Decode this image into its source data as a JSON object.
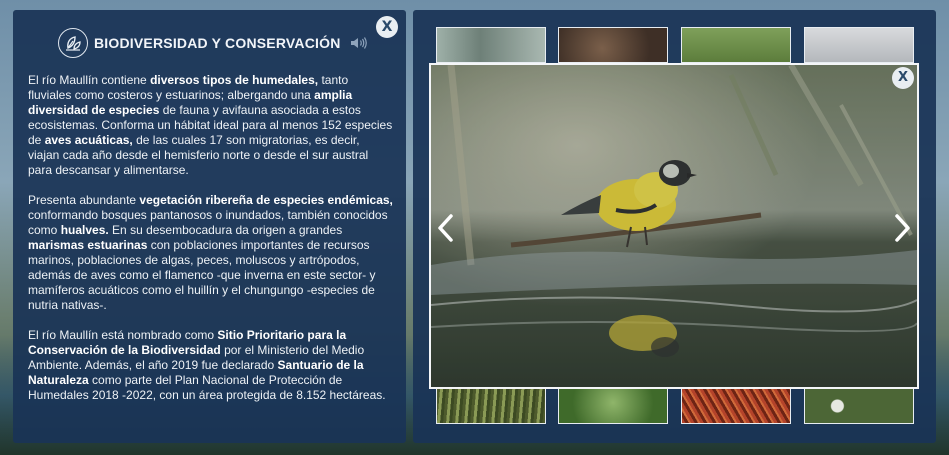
{
  "info": {
    "title": "BIODIVERSIDAD Y CONSERVACIÓN",
    "close_label": "X",
    "icons": {
      "badge": "ecology-leaves-icon",
      "audio": "speaker-icon"
    },
    "paragraphs": [
      [
        {
          "t": "El río Maullín contiene ",
          "b": false
        },
        {
          "t": "diversos tipos de humedales,",
          "b": true
        },
        {
          "t": " tanto fluviales como costeros y estuarinos; albergando una ",
          "b": false
        },
        {
          "t": "amplia diversidad de especies",
          "b": true
        },
        {
          "t": " de fauna y avifauna asociada a estos ecosistemas. Conforma un hábitat ideal para al menos 152 especies de ",
          "b": false
        },
        {
          "t": "aves acuáticas,",
          "b": true
        },
        {
          "t": " de las cuales 17 son migratorias, es decir, viajan cada año desde el hemisferio norte o desde el sur austral para descansar y alimentarse.",
          "b": false
        }
      ],
      [
        {
          "t": "Presenta abundante ",
          "b": false
        },
        {
          "t": "vegetación ribereña de especies endémicas,",
          "b": true
        },
        {
          "t": " conformando bosques pantanosos o inundados, también conocidos como ",
          "b": false
        },
        {
          "t": "hualves.",
          "b": true
        },
        {
          "t": " En su desembocadura da origen a grandes ",
          "b": false
        },
        {
          "t": "marismas estuarinas",
          "b": true
        },
        {
          "t": " con poblaciones importantes de recursos marinos, poblaciones de algas, peces, moluscos y artrópodos, además de aves como el flamenco -que inverna en este sector- y mamíferos acuáticos como el huillín y el chungungo -especies de nutria nativas-.",
          "b": false
        }
      ],
      [
        {
          "t": "El río Maullín está nombrado como ",
          "b": false
        },
        {
          "t": "Sitio Prioritario para la Conservación de la Biodiversidad",
          "b": true
        },
        {
          "t": " por el Ministerio del Medio Ambiente. Además, el año 2019 fue declarado ",
          "b": false
        },
        {
          "t": "Santuario de la Naturaleza",
          "b": true
        },
        {
          "t": " como parte del Plan Nacional de Protección de Humedales 2018 -2022, con un área protegida de 8.152 hectáreas.",
          "b": false
        }
      ]
    ]
  },
  "gallery": {
    "close_label": "X",
    "icons": {
      "prev": "chevron-left-icon",
      "next": "chevron-right-icon"
    },
    "colors": {
      "panel": "#1a3456",
      "thumb_top": [
        "#8fa29a",
        "#5b4638",
        "#6f8f4a",
        "#c9ccd0"
      ],
      "thumb_bottom": [
        "#6d7a4a",
        "#5f7f3f",
        "#a0452c",
        "#4f6a3a"
      ]
    }
  }
}
